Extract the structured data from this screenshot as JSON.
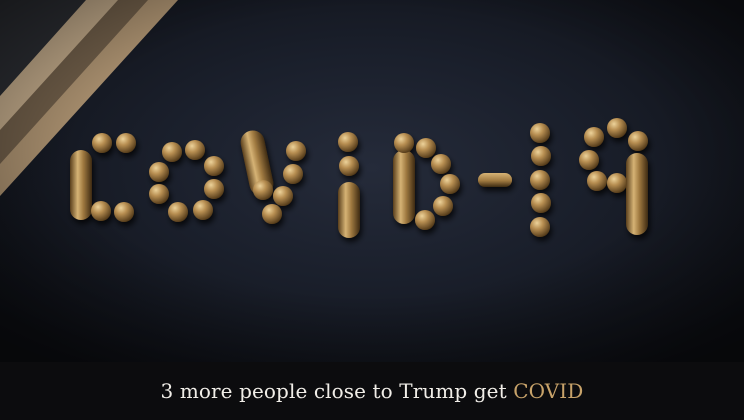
{
  "photo": {
    "alt_text": "COVID-19",
    "palette": {
      "background": "#1a1f2b",
      "pill_gold": "#b88f52",
      "pill_highlight": "#e3c98b",
      "pill_shadow": "#5e4320"
    }
  },
  "caption": {
    "prefix": "3 more people close to Trump get ",
    "highlight": "COVID",
    "highlight_color": "#c8a36a"
  }
}
